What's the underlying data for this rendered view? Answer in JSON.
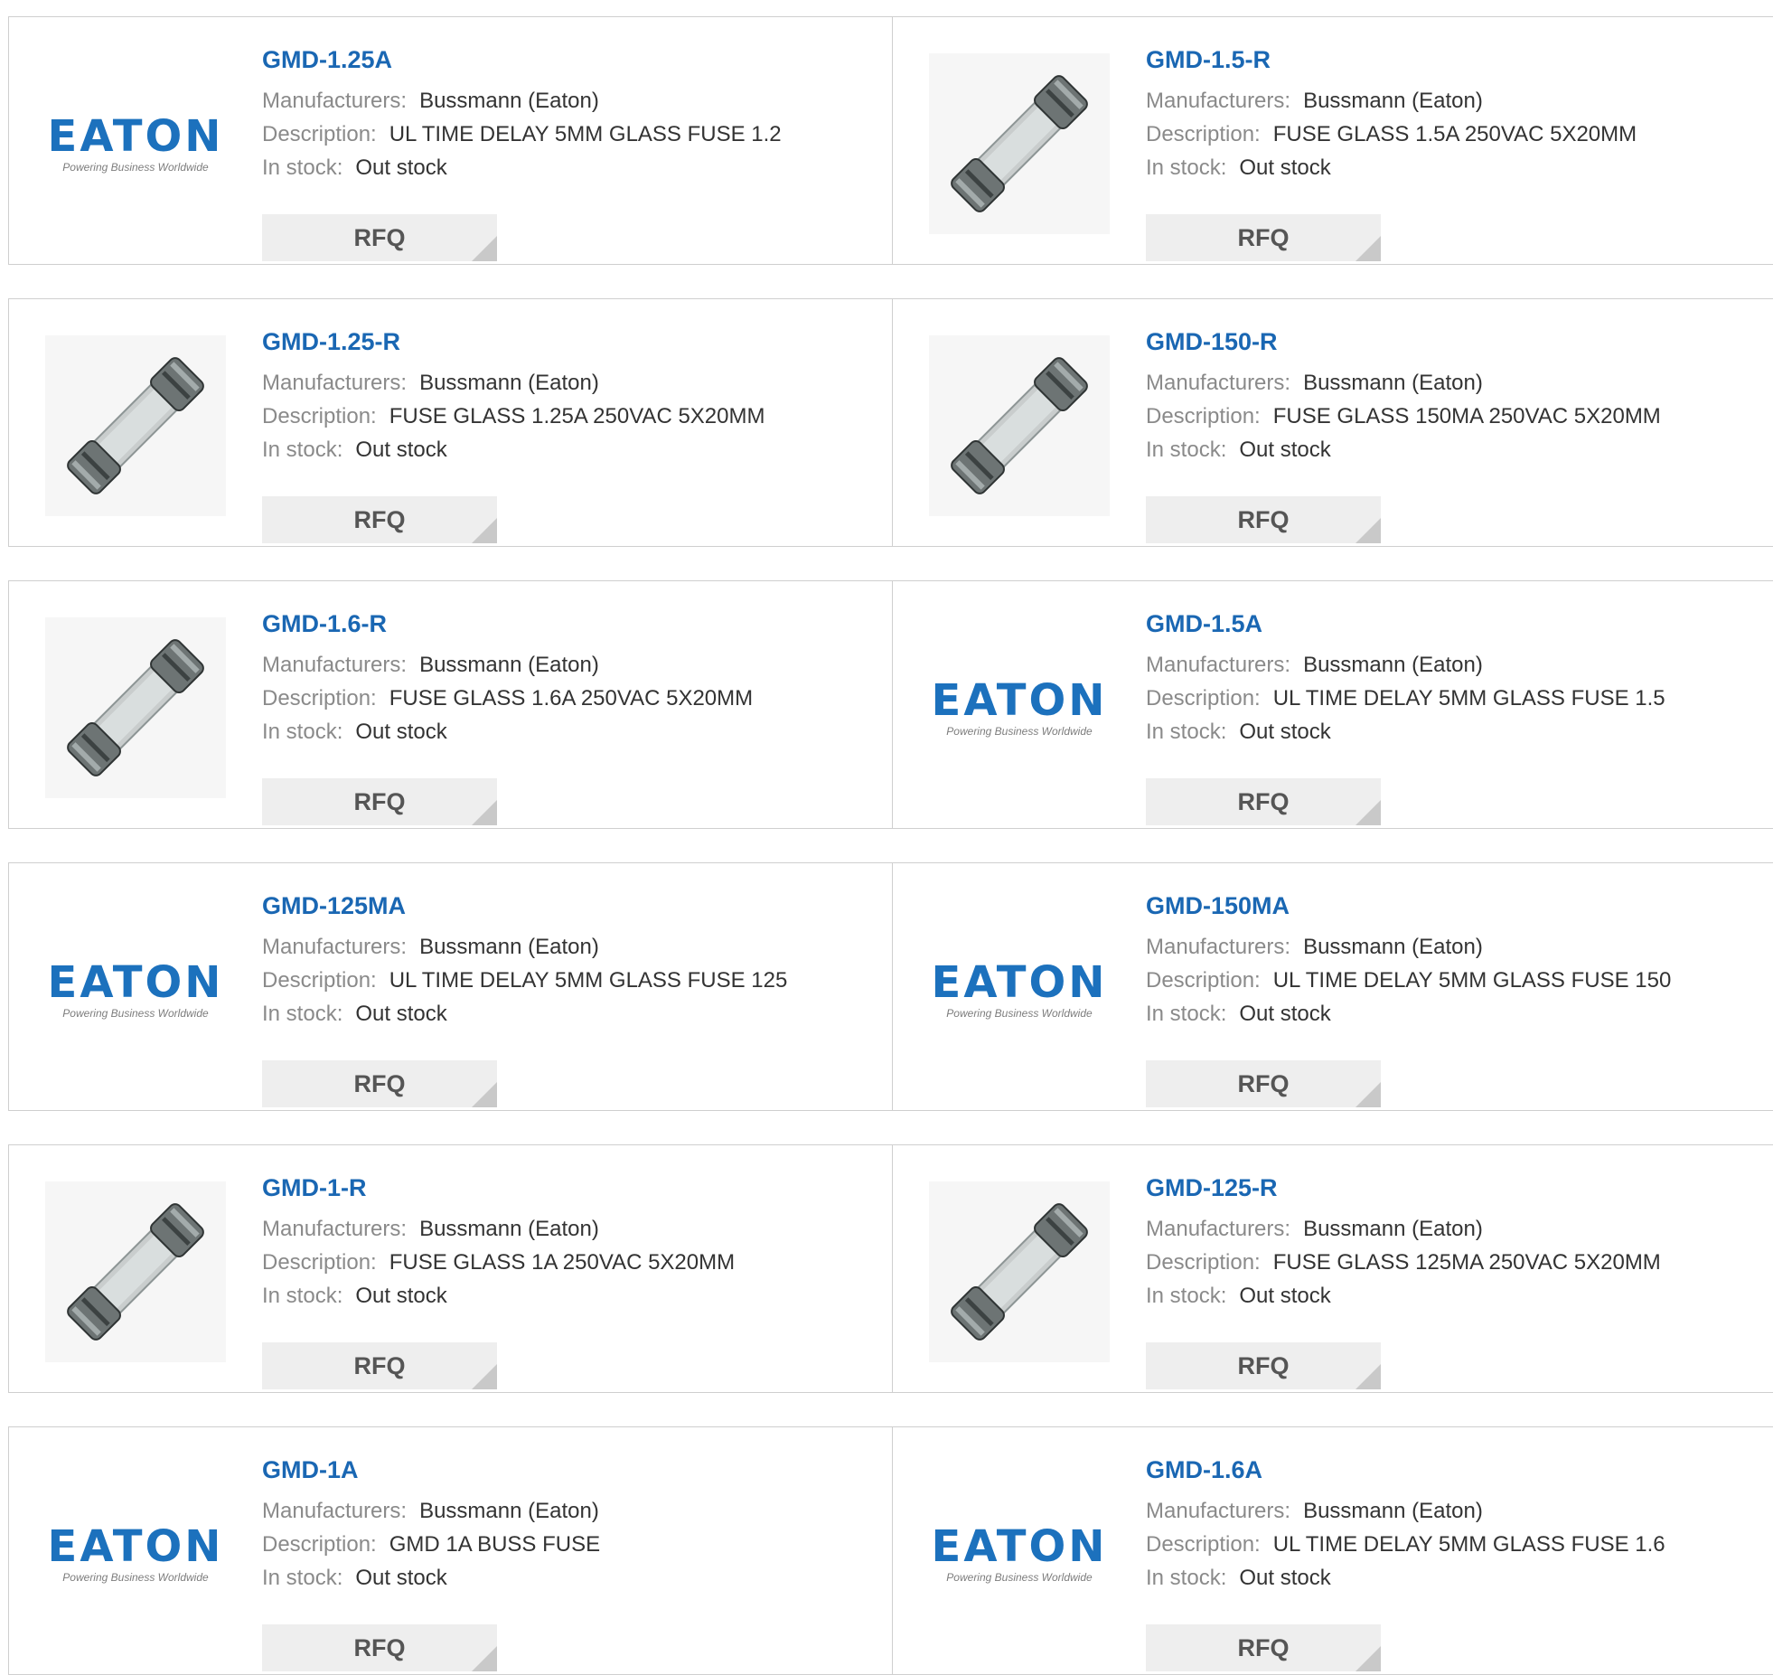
{
  "labels": {
    "manufacturers": "Manufacturers:",
    "description": "Description:",
    "in_stock": "In stock:",
    "rfq": "RFQ"
  },
  "logo": {
    "wordmark": "EATON",
    "tagline": "Powering Business Worldwide"
  },
  "colors": {
    "title_blue": "#1a67b3",
    "logo_blue": "#1c71bd"
  },
  "products": [
    {
      "part": "GMD-1.25A",
      "manufacturer": "Bussmann (Eaton)",
      "description": "UL TIME DELAY 5MM GLASS FUSE 1.2",
      "stock": "Out stock",
      "image": "eaton-logo"
    },
    {
      "part": "GMD-1.5-R",
      "manufacturer": "Bussmann (Eaton)",
      "description": "FUSE GLASS 1.5A 250VAC 5X20MM",
      "stock": "Out stock",
      "image": "fuse-photo"
    },
    {
      "part": "GMD-1.25-R",
      "manufacturer": "Bussmann (Eaton)",
      "description": "FUSE GLASS 1.25A 250VAC 5X20MM",
      "stock": "Out stock",
      "image": "fuse-photo"
    },
    {
      "part": "GMD-150-R",
      "manufacturer": "Bussmann (Eaton)",
      "description": "FUSE GLASS 150MA 250VAC 5X20MM",
      "stock": "Out stock",
      "image": "fuse-photo"
    },
    {
      "part": "GMD-1.6-R",
      "manufacturer": "Bussmann (Eaton)",
      "description": "FUSE GLASS 1.6A 250VAC 5X20MM",
      "stock": "Out stock",
      "image": "fuse-photo"
    },
    {
      "part": "GMD-1.5A",
      "manufacturer": "Bussmann (Eaton)",
      "description": "UL TIME DELAY 5MM GLASS FUSE 1.5",
      "stock": "Out stock",
      "image": "eaton-logo"
    },
    {
      "part": "GMD-125MA",
      "manufacturer": "Bussmann (Eaton)",
      "description": "UL TIME DELAY 5MM GLASS FUSE 125",
      "stock": "Out stock",
      "image": "eaton-logo"
    },
    {
      "part": "GMD-150MA",
      "manufacturer": "Bussmann (Eaton)",
      "description": "UL TIME DELAY 5MM GLASS FUSE 150",
      "stock": "Out stock",
      "image": "eaton-logo"
    },
    {
      "part": "GMD-1-R",
      "manufacturer": "Bussmann (Eaton)",
      "description": "FUSE GLASS 1A 250VAC 5X20MM",
      "stock": "Out stock",
      "image": "fuse-photo"
    },
    {
      "part": "GMD-125-R",
      "manufacturer": "Bussmann (Eaton)",
      "description": "FUSE GLASS 125MA 250VAC 5X20MM",
      "stock": "Out stock",
      "image": "fuse-photo"
    },
    {
      "part": "GMD-1A",
      "manufacturer": "Bussmann (Eaton)",
      "description": "GMD 1A BUSS FUSE",
      "stock": "Out stock",
      "image": "eaton-logo"
    },
    {
      "part": "GMD-1.6A",
      "manufacturer": "Bussmann (Eaton)",
      "description": "UL TIME DELAY 5MM GLASS FUSE 1.6",
      "stock": "Out stock",
      "image": "eaton-logo"
    }
  ]
}
